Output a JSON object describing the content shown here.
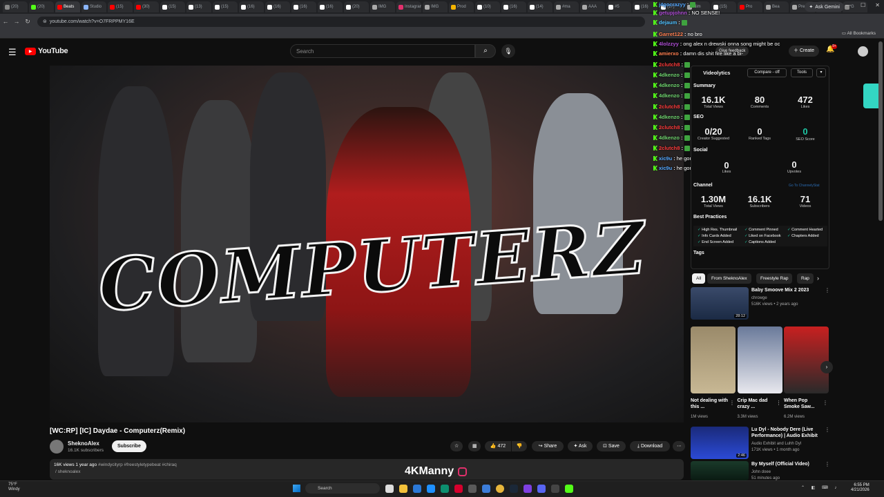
{
  "browser": {
    "tabs": [
      "(20)",
      "(20)",
      "Beats",
      "Studio",
      "(15)",
      "(30)",
      "(15)",
      "(13)",
      "(15)",
      "(16)",
      "(16)",
      "(16)",
      "(16)",
      "(20)",
      "IMG",
      "Instagram",
      "IMG",
      "Prod",
      "(10)",
      "(16)",
      "(14)",
      "#ma",
      "AAA",
      "#5",
      "(16)",
      "(17)",
      "Nim",
      "(15)",
      "Pro",
      "Bea",
      "Pre",
      "(7)",
      "G"
    ],
    "ask_gemini": "Ask Gemini",
    "url": "youtube.com/watch?v=O7FRPPMY16E",
    "all_bookmarks": "All Bookmarks"
  },
  "youtube": {
    "logo": "YouTube",
    "search_placeholder": "Search",
    "give_feedback": "Give feedback",
    "create": "Create",
    "notif_count": "9+"
  },
  "video": {
    "art_text": "COMPUTERZ",
    "title": "[WC:RP] [IC] Daydae - Computerz(Remix)",
    "channel": "SheknoAlex",
    "subscribers": "16.1K subscribers",
    "subscribe": "Subscribe",
    "likes": "472",
    "share": "Share",
    "ask": "Ask",
    "save": "Save",
    "download": "Download",
    "views_time": "16K views  1 year ago",
    "hashtags": "#windycityrp #freestyletypebeat #chiraq",
    "desc_link": "/ sheknoalex",
    "watermark": "4KManny"
  },
  "chat": [
    {
      "user": "j4gocrazyy",
      "color": "#53a7ff",
      "msg": ""
    },
    {
      "user": "getupjohnn",
      "color": "#b04fd6",
      "msg": "NO SENSE!"
    },
    {
      "user": "dejaum",
      "color": "#4fc1ff",
      "msg": ""
    },
    {
      "user": "Garret122",
      "color": "#ff7f50",
      "msg": "no bro"
    },
    {
      "user": "4lolzzyy",
      "color": "#b04fd6",
      "msg": "ong alex n drewski onna song might be oc"
    },
    {
      "user": "amierxo",
      "color": "#ff7f50",
      "msg": "damn dis shit fire like a bi-"
    },
    {
      "user": "2clutch8",
      "color": "#ff3b3b",
      "msg": ""
    },
    {
      "user": "4dkenzo",
      "color": "#6fd36f",
      "msg": ""
    },
    {
      "user": "4dkenzo",
      "color": "#6fd36f",
      "msg": ""
    },
    {
      "user": "4dkenzo",
      "color": "#6fd36f",
      "msg": ""
    },
    {
      "user": "2clutch8",
      "color": "#ff3b3b",
      "msg": ""
    },
    {
      "user": "4dkenzo",
      "color": "#6fd36f",
      "msg": ""
    },
    {
      "user": "2clutch8",
      "color": "#ff3b3b",
      "msg": ""
    },
    {
      "user": "4dkenzo",
      "color": "#6fd36f",
      "msg": ""
    },
    {
      "user": "2clutch8",
      "color": "#ff3b3b",
      "msg": ""
    },
    {
      "user": "xic9u",
      "color": "#53a7ff",
      "msg": "he gon be in the faction"
    },
    {
      "user": "xic9u",
      "color": "#53a7ff",
      "msg": "he gon be in the faction"
    }
  ],
  "videolytics": {
    "title": "Videolytics",
    "compare": "Compare - off",
    "tools": "Tools",
    "summary": "Summary",
    "total_views": "16.1K",
    "total_views_lbl": "Total Views",
    "comments": "80",
    "comments_lbl": "Comments",
    "likes": "472",
    "likes_lbl": "Likes",
    "seo": "SEO",
    "creator_suggested": "0/20",
    "creator_suggested_lbl": "Creator Suggested",
    "ranked_tags": "0",
    "ranked_tags_lbl": "Ranked Tags",
    "seo_score": "0",
    "seo_score_lbl": "SEO Score",
    "social": "Social",
    "social_likes": "0",
    "social_likes_lbl": "Likes",
    "upvotes": "0",
    "upvotes_lbl": "Upvotes",
    "channel": "Channel",
    "go_to_channel": "Go To ChannelyStat",
    "ch_views": "1.30M",
    "ch_views_lbl": "Total Views",
    "ch_subs": "16.1K",
    "ch_subs_lbl": "Subscribers",
    "ch_videos": "71",
    "ch_videos_lbl": "Videos",
    "best_practices": "Best Practices",
    "bp": [
      "High Res. Thumbnail",
      "Comment Pinned",
      "Comment Hearted",
      "Info Cards Added",
      "Liked on Facebook",
      "Chapters Added",
      "End Screen Added",
      "Captions Added"
    ],
    "tags": "Tags"
  },
  "chips": [
    "All",
    "From SheknoAlex",
    "Freestyle Rap",
    "Rap"
  ],
  "recommendations": [
    {
      "title": "Baby Smoove Mix 2 2023",
      "channel": "chrowge",
      "meta": "516K views • 2 years ago",
      "duration": "28:12"
    },
    {
      "title": "Lu Dyl - Nobody Dere (Live Performance) | Audio Exhibit",
      "channel": "Audio Exhibit and Luhh Dyl",
      "meta": "171K views • 1 month ago",
      "duration": "2:46"
    },
    {
      "title": "By Myself (Official Video)",
      "channel": "John doee",
      "meta": "51 minutes ago",
      "duration": ""
    }
  ],
  "shorts": [
    {
      "title": "Not dealing with this ...",
      "views": "1M views"
    },
    {
      "title": "Crip Mac dad crazy ...",
      "views": "3.3M views"
    },
    {
      "title": "When Pop Smoke Saw...",
      "views": "6.2M views"
    }
  ],
  "taskbar": {
    "temp": "75°F",
    "weather": "Windy",
    "search": "Search",
    "time": "6:55 PM",
    "date": "4/21/2026"
  }
}
